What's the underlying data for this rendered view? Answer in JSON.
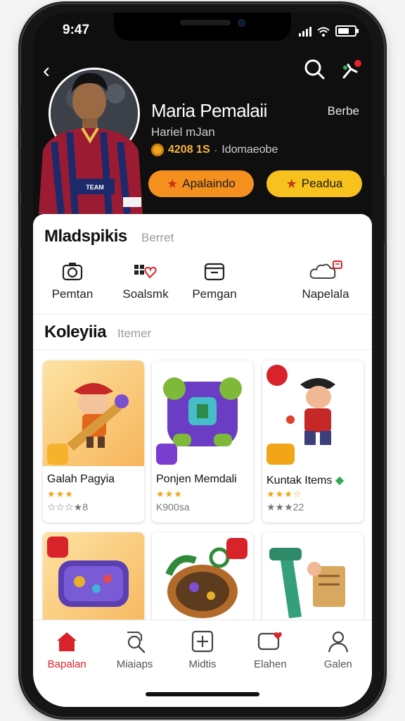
{
  "status_bar": {
    "time": "9:47"
  },
  "profile": {
    "name": "Maria Pemalaii",
    "follow_label": "Berbe",
    "subtitle": "Hariel mJan",
    "coins": "4208 1S",
    "coins_sub": "Idomaeobe",
    "action_primary": "Apalaindo",
    "action_secondary": "Peadua",
    "accent_orange": "#f5901f",
    "accent_yellow": "#f7c21d"
  },
  "header_icons": {
    "back": "back-arrow-icon",
    "search": "search-icon",
    "notify": "notification-icon"
  },
  "quick_section": {
    "title": "Mladspikis",
    "subtitle": "Berret",
    "items": [
      {
        "label": "Pemtan",
        "icon": "camera-icon"
      },
      {
        "label": "Soalsmk",
        "icon": "grid-heart-icon"
      },
      {
        "label": "Pemgan",
        "icon": "folder-icon"
      },
      {
        "label": "Napelala",
        "icon": "cloud-icon"
      }
    ]
  },
  "collection": {
    "title": "Koleyiia",
    "subtitle": "Itemer",
    "items": [
      {
        "name": "Galah Pagyia",
        "stars": "★★★",
        "meta": "☆☆☆★8"
      },
      {
        "name": "Ponjen Memdali",
        "stars": "★★★",
        "meta": "K900sa"
      },
      {
        "name": "Kuntak Items",
        "stars": "★★★☆",
        "meta": "★★★22"
      },
      {
        "name": "",
        "stars": "",
        "meta": ""
      },
      {
        "name": "",
        "stars": "",
        "meta": ""
      },
      {
        "name": "",
        "stars": "",
        "meta": ""
      }
    ]
  },
  "nav": {
    "items": [
      {
        "label": "Bapalan",
        "icon": "home-icon",
        "active": true
      },
      {
        "label": "Miaiaps",
        "icon": "search-doc-icon"
      },
      {
        "label": "Midtis",
        "icon": "plus-box-icon"
      },
      {
        "label": "Elahen",
        "icon": "chat-heart-icon"
      },
      {
        "label": "Galen",
        "icon": "user-icon"
      }
    ]
  }
}
